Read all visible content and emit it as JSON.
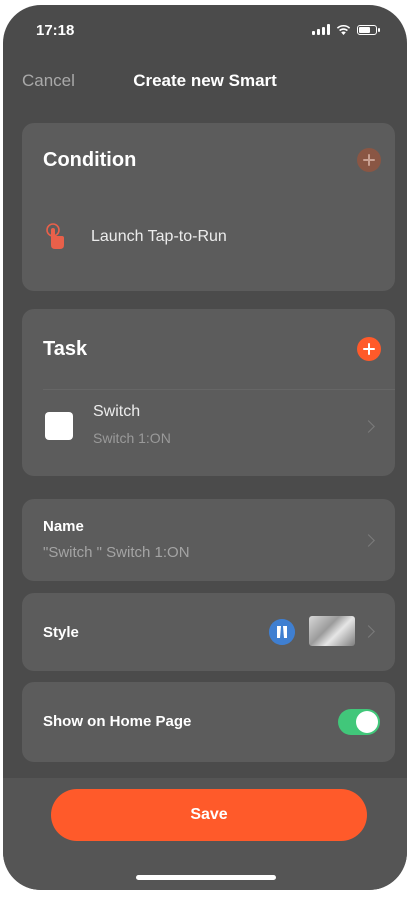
{
  "status_bar": {
    "time": "17:18"
  },
  "nav": {
    "cancel_label": "Cancel",
    "title": "Create new Smart"
  },
  "condition": {
    "title": "Condition",
    "item_label": "Launch Tap-to-Run",
    "item_icon": "tap-hand-icon"
  },
  "task": {
    "title": "Task",
    "items": [
      {
        "name": "Switch",
        "detail": "Switch 1:ON",
        "icon": "device-icon"
      }
    ]
  },
  "name_row": {
    "label": "Name",
    "value": "\"Switch \" Switch 1:ON"
  },
  "style_row": {
    "label": "Style"
  },
  "home_row": {
    "label": "Show on Home Page",
    "enabled": true
  },
  "save": {
    "label": "Save"
  },
  "colors": {
    "accent": "#ff5a2a",
    "toggle_on": "#41c77a",
    "background": "#4b4b4b",
    "card": "#5c5c5c"
  }
}
